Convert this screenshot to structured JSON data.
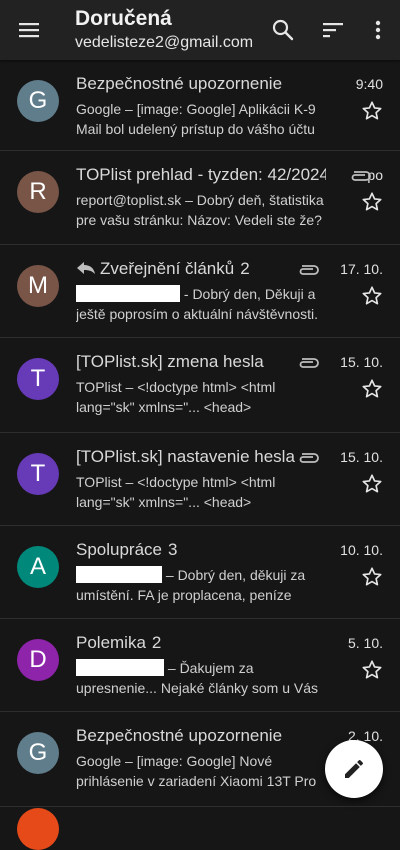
{
  "header": {
    "title": "Doručená",
    "account": "vedelisteze2@gmail.com"
  },
  "messages": [
    {
      "avatar_letter": "G",
      "avatar_color": "#607d8b",
      "subject": "Bezpečnostné upozornenie",
      "count": "",
      "date": "9:40",
      "attachment": false,
      "replied": false,
      "preview_prefix": "",
      "preview": "Google – [image: Google] Aplikácii K-9 Mail bol udelený prístup do vášho účtu"
    },
    {
      "avatar_letter": "R",
      "avatar_color": "#795548",
      "subject": "TOPlist prehlad - tyzden: 42/2024",
      "count": "",
      "date": "po",
      "attachment": true,
      "replied": false,
      "preview_prefix": "",
      "preview": "report@toplist.sk – Dobrý deň, štatistika pre vašu stránku: Názov: Vedeli ste že? ID:"
    },
    {
      "avatar_letter": "M",
      "avatar_color": "#795548",
      "subject": "Zveřejnění článků",
      "count": "2",
      "date": "17. 10.",
      "attachment": true,
      "replied": true,
      "preview_prefix": "redacted",
      "preview": "- Dobrý den, Děkuji a ještě poprosím o aktuální návštěvnosti."
    },
    {
      "avatar_letter": "T",
      "avatar_color": "#673ab7",
      "subject": "[TOPlist.sk] zmena hesla",
      "count": "",
      "date": "15. 10.",
      "attachment": true,
      "replied": false,
      "preview_prefix": "",
      "preview": "TOPlist – <!doctype html> <html lang=\"sk\" xmlns=\"... <head>"
    },
    {
      "avatar_letter": "T",
      "avatar_color": "#673ab7",
      "subject": "[TOPlist.sk] nastavenie hesla",
      "count": "",
      "date": "15. 10.",
      "attachment": true,
      "replied": false,
      "preview_prefix": "",
      "preview": "TOPlist – <!doctype html> <html lang=\"sk\" xmlns=\"... <head>"
    },
    {
      "avatar_letter": "A",
      "avatar_color": "#00897b",
      "subject": "Spolupráce",
      "count": "3",
      "date": "10. 10.",
      "attachment": false,
      "replied": false,
      "preview_prefix": "redacted",
      "preview": "– Dobrý den, děkuji za umístění. FA je proplacena, peníze"
    },
    {
      "avatar_letter": "D",
      "avatar_color": "#8e24aa",
      "subject": "Polemika",
      "count": "2",
      "date": "5. 10.",
      "attachment": false,
      "replied": false,
      "preview_prefix": "redacted",
      "preview": "– Ďakujem za upresnenie... Nejaké články som u Vás čítal...vrtuľové"
    },
    {
      "avatar_letter": "G",
      "avatar_color": "#607d8b",
      "subject": "Bezpečnostné upozornenie",
      "count": "",
      "date": "2. 10.",
      "attachment": false,
      "replied": false,
      "preview_prefix": "",
      "preview": "Google – [image: Google] Nové prihlásenie v zariadení Xiaomi 13T Pro"
    }
  ],
  "icons": {
    "menu": "menu-icon",
    "search": "search-icon",
    "sort": "sort-icon",
    "more": "more-vert-icon",
    "star": "star-outline-icon",
    "attachment": "attachment-icon",
    "replied": "reply-icon",
    "compose": "pencil-icon"
  },
  "colors": {
    "background": "#161616",
    "appbar": "#222222",
    "fab": "#ffffff"
  }
}
